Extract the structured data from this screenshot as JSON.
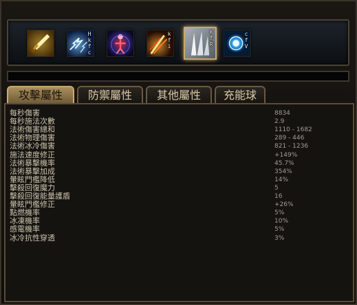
{
  "skills": [
    {
      "name": "sword-skill-icon",
      "keys": []
    },
    {
      "name": "lightning-hands-skill-icon",
      "keys": [
        "H",
        "k",
        "f",
        "c"
      ]
    },
    {
      "name": "figure-aura-skill-icon",
      "keys": []
    },
    {
      "name": "fire-streak-skill-icon",
      "keys": [
        "k",
        "f",
        "i"
      ]
    },
    {
      "name": "ice-shard-skill-icon",
      "keys": [
        "k",
        "f",
        "R"
      ]
    },
    {
      "name": "blue-orb-skill-icon",
      "keys": [
        "c",
        "f",
        "V"
      ]
    }
  ],
  "tabs": [
    "攻擊屬性",
    "防禦屬性",
    "其他屬性",
    "充能球"
  ],
  "active_tab": 0,
  "stats": [
    {
      "label": "每秒傷害",
      "value": "8834"
    },
    {
      "label": "每秒施法次數",
      "value": "2.9"
    },
    {
      "label": "法術傷害總和",
      "value": "1110 - 1682"
    },
    {
      "label": "法術物理傷害",
      "value": "289 - 446"
    },
    {
      "label": "法術冰冷傷害",
      "value": "821 - 1236"
    },
    {
      "label": "施法速度修正",
      "value": "+149%"
    },
    {
      "label": "法術暴擊機率",
      "value": "45.7%"
    },
    {
      "label": "法術暴擊加成",
      "value": "354%"
    },
    {
      "label": "暈眩門檻降低",
      "value": "14%"
    },
    {
      "label": "擊殺回復魔力",
      "value": "5"
    },
    {
      "label": "擊殺回復能量護盾",
      "value": "16"
    },
    {
      "label": "暈眩門檻修正",
      "value": "+26%"
    },
    {
      "label": "點燃機率",
      "value": "5%"
    },
    {
      "label": "冰凍機率",
      "value": "10%"
    },
    {
      "label": "感電機率",
      "value": "5%"
    },
    {
      "label": "冰冷抗性穿透",
      "value": "3%"
    }
  ]
}
